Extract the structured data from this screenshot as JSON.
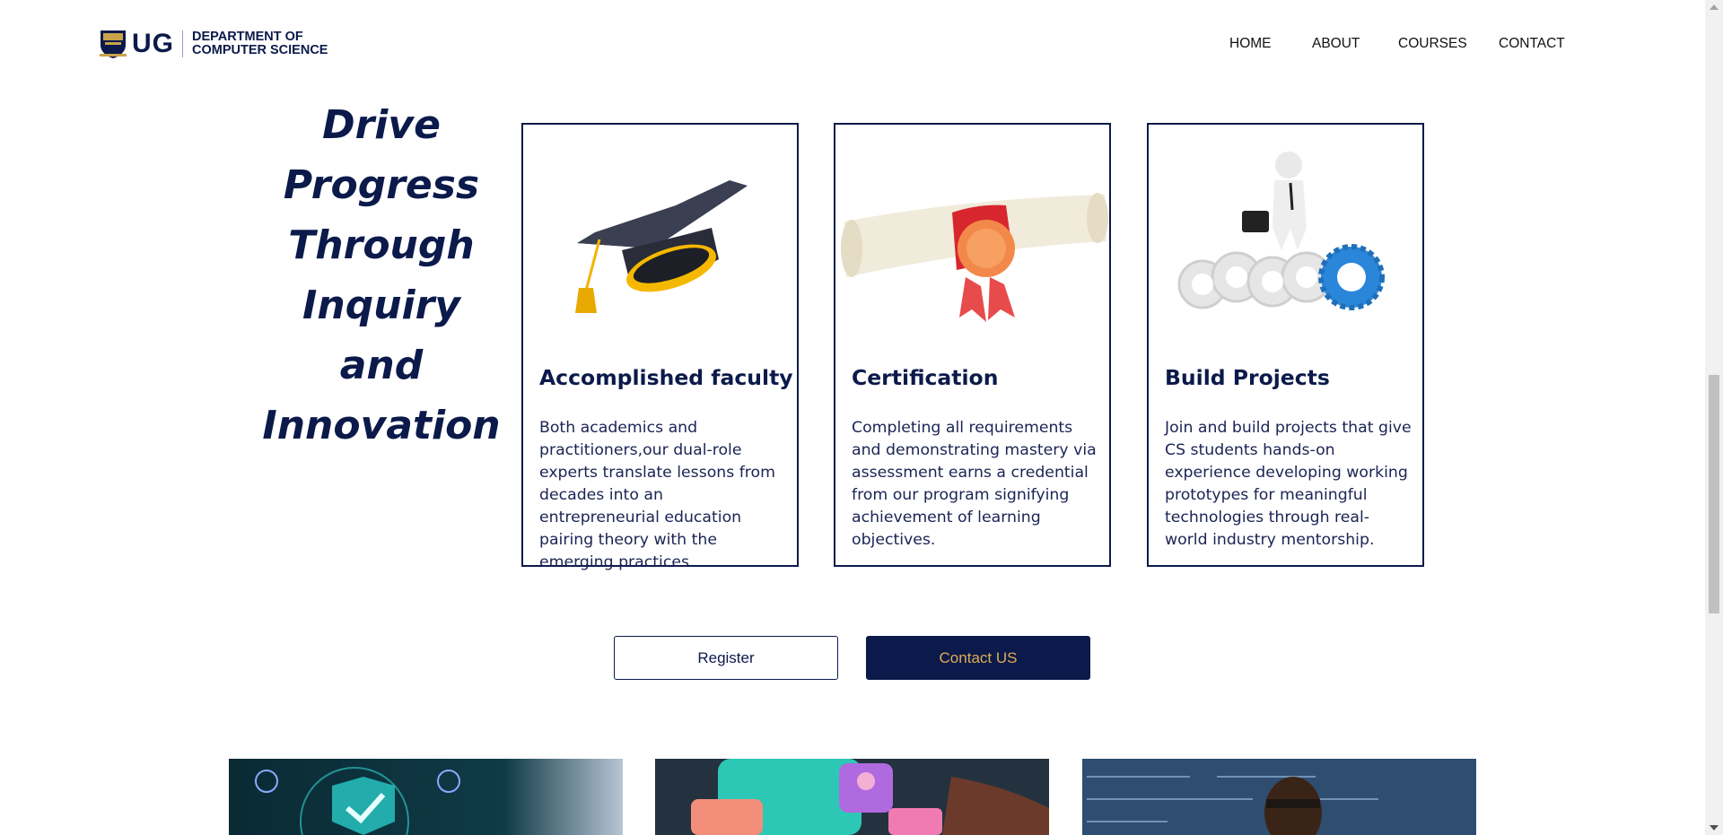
{
  "brand": {
    "short": "UG",
    "dept_line1": "DEPARTMENT OF",
    "dept_line2": "COMPUTER SCIENCE"
  },
  "nav": {
    "home": "HOME",
    "about": "ABOUT",
    "courses": "COURSES",
    "contact": "CONTACT"
  },
  "hero": {
    "line1": "Drive",
    "line2": "Progress",
    "line3": "Through",
    "line4": "Inquiry",
    "line5": "and",
    "line6": "Innovation"
  },
  "cards": [
    {
      "title": "Accomplished faculty",
      "text": "Both academics and practitioners,our dual-role experts translate lessons from decades into an entrepreneurial education pairing theory with the emerging practices.",
      "icon": "graduation-cap-icon"
    },
    {
      "title": "Certification",
      "text": "Completing all requirements and demonstrating mastery via assessment earns a credential from our program signifying achievement of learning objectives.",
      "icon": "diploma-scroll-icon"
    },
    {
      "title": "Build Projects",
      "text": "Join and build projects that give CS students hands-on experience developing working prototypes for meaningful technologies through real-world industry mentorship.",
      "icon": "figure-on-gears-icon"
    }
  ],
  "buttons": {
    "register": "Register",
    "contact_us": "Contact US"
  },
  "colors": {
    "navy": "#0b1a4a",
    "gold": "#e0ac55"
  }
}
